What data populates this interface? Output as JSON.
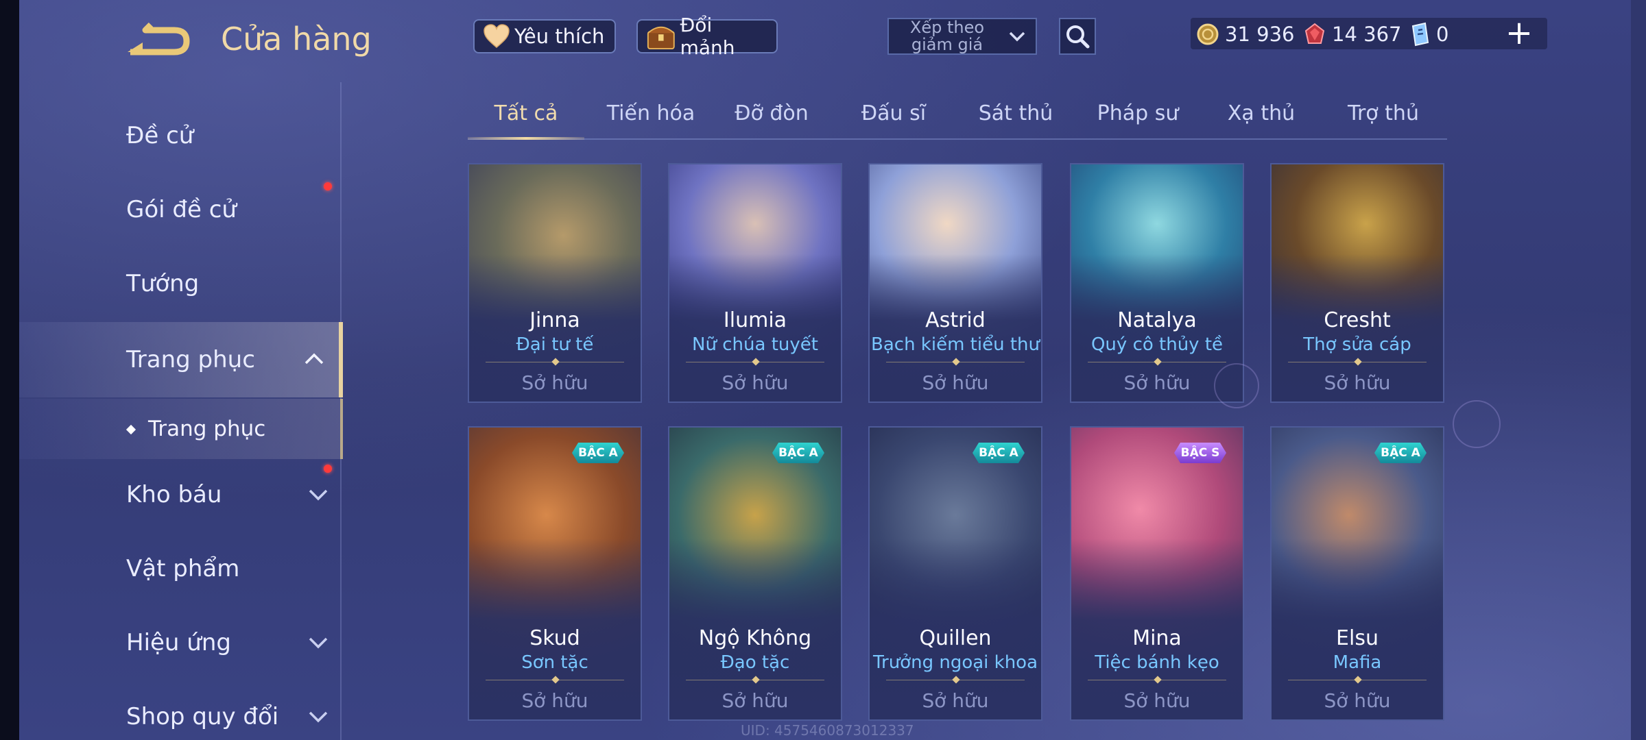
{
  "header": {
    "title": "Cửa hàng",
    "favorite_label": "Yêu thích",
    "shard_label": "Đổi mảnh",
    "sort_label": "Xếp theo giảm giá",
    "currencies": {
      "gold": "31 936",
      "red": "14 367",
      "ticket": "0"
    },
    "plus": "+"
  },
  "sidebar": {
    "items": [
      {
        "label": "Đề cử"
      },
      {
        "label": "Gói đề cử"
      },
      {
        "label": "Tướng"
      },
      {
        "label": "Trang phục"
      },
      {
        "label": "Kho báu"
      },
      {
        "label": "Vật phẩm"
      },
      {
        "label": "Hiệu ứng"
      },
      {
        "label": "Shop quy đổi"
      }
    ],
    "sub_item": {
      "label": "Trang phục"
    }
  },
  "tabs": [
    "Tất cả",
    "Tiến hóa",
    "Đỡ đòn",
    "Đấu sĩ",
    "Sát thủ",
    "Pháp sư",
    "Xạ thủ",
    "Trợ thủ"
  ],
  "cards": [
    {
      "name": "Jinna",
      "skin": "Đại tư tế",
      "status": "Sở hữu",
      "rank": ""
    },
    {
      "name": "Ilumia",
      "skin": "Nữ chúa tuyết",
      "status": "Sở hữu",
      "rank": ""
    },
    {
      "name": "Astrid",
      "skin": "Bạch kiếm tiểu thư",
      "status": "Sở hữu",
      "rank": ""
    },
    {
      "name": "Natalya",
      "skin": "Quý cô thủy tề",
      "status": "Sở hữu",
      "rank": ""
    },
    {
      "name": "Cresht",
      "skin": "Thợ sửa cáp",
      "status": "Sở hữu",
      "rank": ""
    },
    {
      "name": "Skud",
      "skin": "Sơn tặc",
      "status": "Sở hữu",
      "rank": "BẬC A"
    },
    {
      "name": "Ngộ Không",
      "skin": "Đạo tặc",
      "status": "Sở hữu",
      "rank": "BẬC A"
    },
    {
      "name": "Quillen",
      "skin": "Trưởng ngoại khoa",
      "status": "Sở hữu",
      "rank": "BẬC A"
    },
    {
      "name": "Mina",
      "skin": "Tiệc bánh kẹo",
      "status": "Sở hữu",
      "rank": "BẬC S"
    },
    {
      "name": "Elsu",
      "skin": "Mafia",
      "status": "Sở hữu",
      "rank": "BẬC A"
    }
  ],
  "uid": "UID: 4575460873012337",
  "colors": {
    "accent_gold": "#f1dcae",
    "skin_blue": "#79c7ff",
    "notify_red": "#ff3a3a"
  }
}
